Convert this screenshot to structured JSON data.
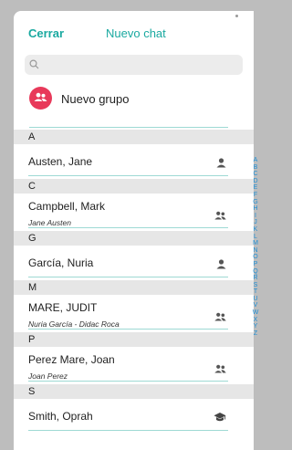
{
  "header": {
    "close_label": "Cerrar",
    "title": "Nuevo chat"
  },
  "search": {
    "placeholder": "",
    "value": ""
  },
  "new_group": {
    "label": "Nuevo grupo"
  },
  "sections": [
    {
      "letter": "A",
      "contacts": [
        {
          "name": "Austen, Jane",
          "subtitle": "",
          "icon": "person-icon"
        }
      ]
    },
    {
      "letter": "C",
      "contacts": [
        {
          "name": "Campbell, Mark",
          "subtitle": "Jane Austen",
          "icon": "group-icon"
        }
      ]
    },
    {
      "letter": "G",
      "contacts": [
        {
          "name": "García, Nuria",
          "subtitle": "",
          "icon": "person-icon"
        }
      ]
    },
    {
      "letter": "M",
      "contacts": [
        {
          "name": "MARE, JUDIT",
          "subtitle": "Nuria García - Didac Roca",
          "icon": "group-icon"
        }
      ]
    },
    {
      "letter": "P",
      "contacts": [
        {
          "name": "Perez Mare, Joan",
          "subtitle": "Joan Perez",
          "icon": "group-icon"
        }
      ]
    },
    {
      "letter": "S",
      "contacts": [
        {
          "name": "Smith, Oprah",
          "subtitle": "",
          "icon": "graduation-cap-icon"
        }
      ]
    }
  ],
  "alphabet_index": [
    "A",
    "B",
    "C",
    "D",
    "E",
    "F",
    "G",
    "H",
    "I",
    "J",
    "K",
    "L",
    "M",
    "N",
    "O",
    "P",
    "Q",
    "R",
    "S",
    "T",
    "U",
    "V",
    "W",
    "X",
    "Y",
    "Z"
  ],
  "colors": {
    "accent": "#1aa9a0",
    "group_button": "#e8395a",
    "index": "#1e8fd6",
    "section_bg": "#e6e6e6"
  }
}
